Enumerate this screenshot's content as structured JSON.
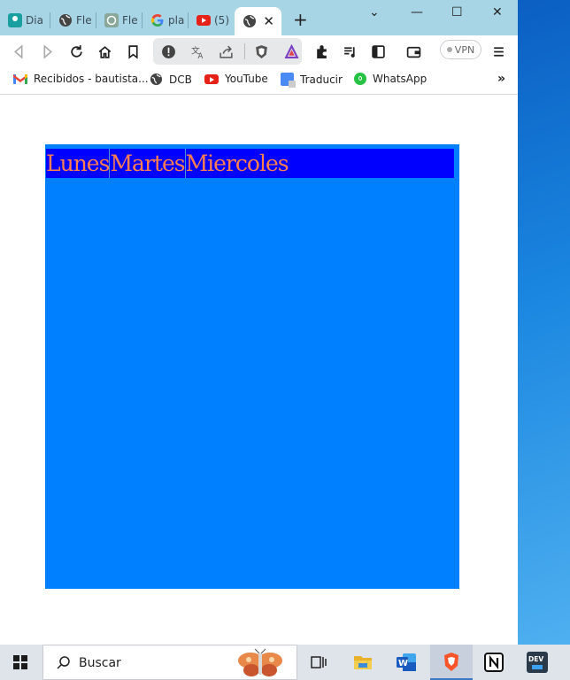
{
  "browser": {
    "tabs": [
      {
        "label": "Dia",
        "icon": "classroom-icon"
      },
      {
        "label": "Fle",
        "icon": "globe-icon"
      },
      {
        "label": "Fle",
        "icon": "chatgpt-icon"
      },
      {
        "label": "pla",
        "icon": "google-icon"
      },
      {
        "label": "(5)",
        "icon": "youtube-icon"
      },
      {
        "label": "",
        "icon": "globe-icon",
        "active": true
      }
    ],
    "close_glyph": "✕",
    "new_tab_glyph": "+",
    "window_controls": {
      "collapse": "⌄",
      "minimize": "—",
      "maximize": "☐",
      "close": "✕"
    },
    "vpn_label": "VPN",
    "bookmarks": [
      {
        "label": "Recibidos - bautista...",
        "icon": "gmail-icon"
      },
      {
        "label": "DCB",
        "icon": "globe-icon"
      },
      {
        "label": "YouTube",
        "icon": "youtube-icon"
      },
      {
        "label": "Traducir",
        "icon": "translate-icon"
      },
      {
        "label": "WhatsApp",
        "icon": "whatsapp-icon"
      }
    ],
    "bookmarks_more": "»"
  },
  "page": {
    "days": [
      "Lunes",
      "Martes",
      "Miercoles"
    ],
    "colors": {
      "box": "#0080ff",
      "row": "#0000ff",
      "text": "#ff7f50"
    }
  },
  "taskbar": {
    "search_placeholder": "Buscar",
    "apps": [
      "task-view-icon",
      "file-explorer-icon",
      "word-icon",
      "brave-icon",
      "notion-icon",
      "dev-icon"
    ],
    "dev_label": "DEV"
  }
}
